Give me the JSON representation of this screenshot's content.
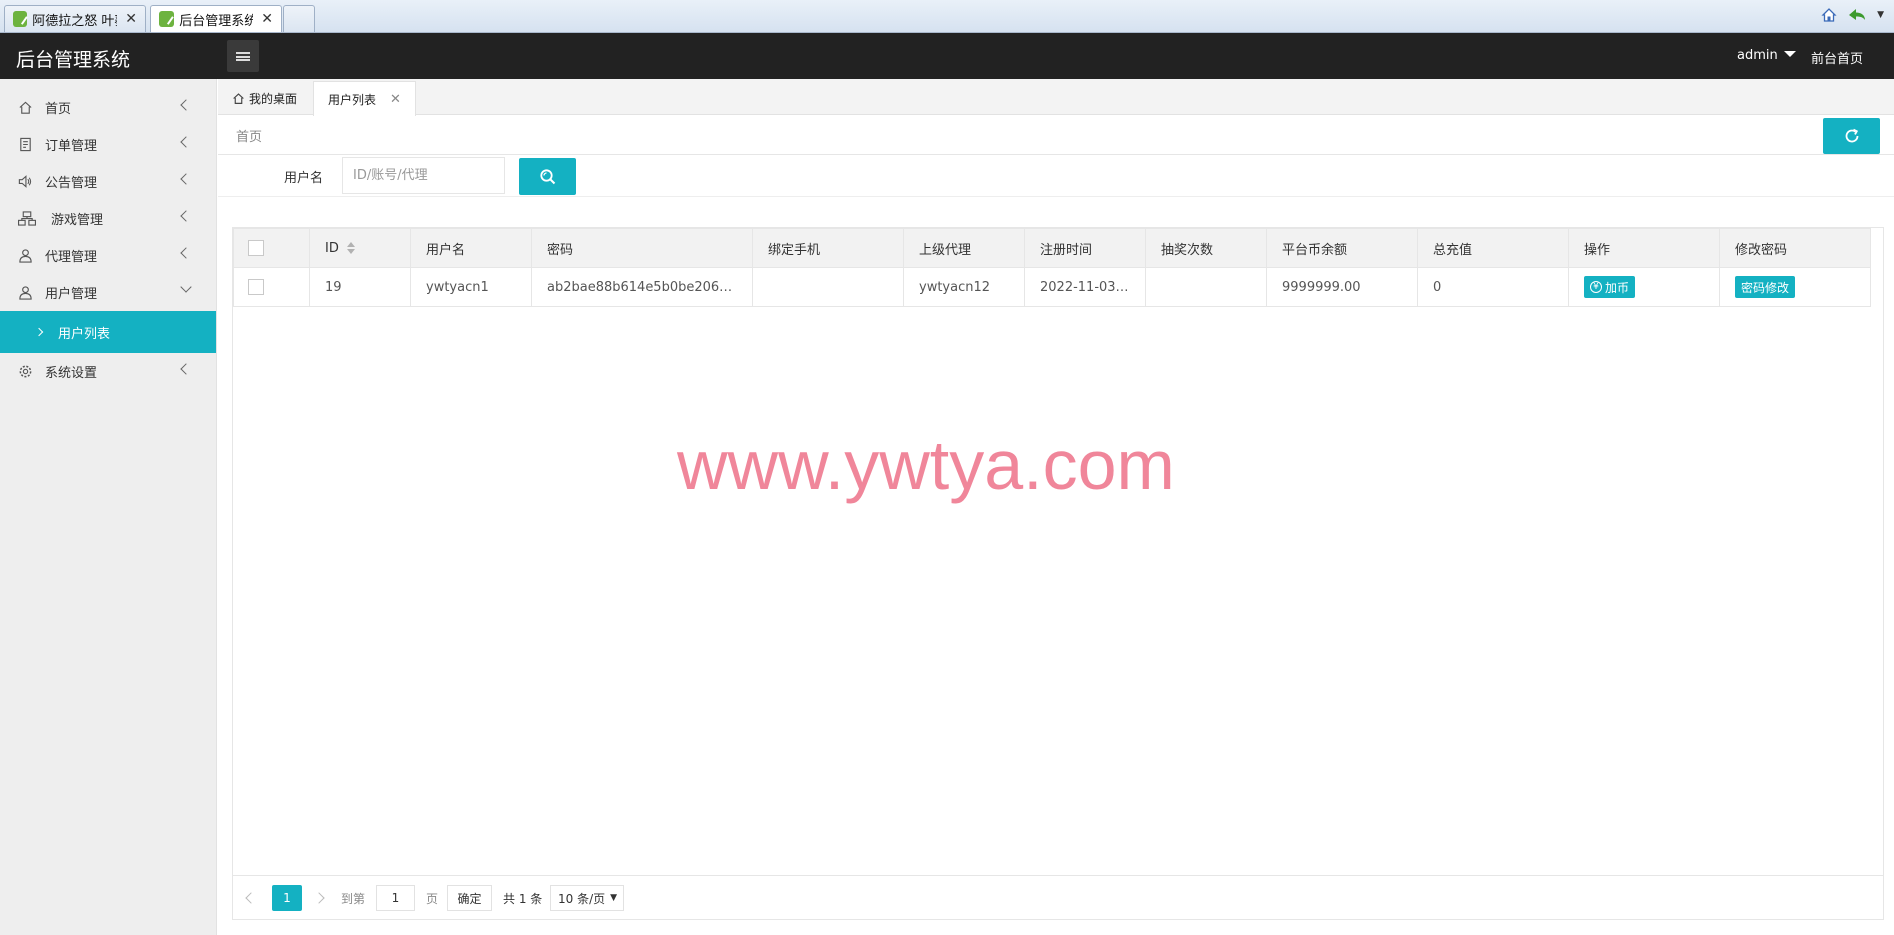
{
  "browser": {
    "tabs": [
      {
        "title": "阿德拉之怒 叶蓁"
      },
      {
        "title": "后台管理系统"
      }
    ]
  },
  "header": {
    "brand": "后台管理系统",
    "user": "admin",
    "front_link": "前台首页"
  },
  "sidebar": {
    "items": [
      {
        "label": "首页"
      },
      {
        "label": "订单管理"
      },
      {
        "label": "公告管理"
      },
      {
        "label": "游戏管理"
      },
      {
        "label": "代理管理"
      },
      {
        "label": "用户管理"
      },
      {
        "label": "系统设置"
      }
    ],
    "sub_item": "用户列表"
  },
  "content_tabs": {
    "desk": "我的桌面",
    "current": "用户列表"
  },
  "breadcrumb": "首页",
  "search": {
    "label": "用户名",
    "placeholder": "ID/账号/代理"
  },
  "table": {
    "headers": [
      "ID",
      "用户名",
      "密码",
      "绑定手机",
      "上级代理",
      "注册时间",
      "抽奖次数",
      "平台币余额",
      "总充值",
      "操作",
      "修改密码"
    ],
    "rows": [
      {
        "id": "19",
        "username": "ywtyacn1",
        "password": "ab2bae88b614e5b0be2061…",
        "phone": "",
        "agent": "ywtyacn12",
        "reg_time": "2022-11-03…",
        "draws": "",
        "balance": "9999999.00",
        "recharge": "0",
        "action": "加币",
        "change_pwd": "密码修改"
      }
    ]
  },
  "watermark": "www.ywtya.com",
  "pagination": {
    "current": "1",
    "goto_label": "到第",
    "goto_value": "1",
    "page_unit": "页",
    "confirm": "确定",
    "total": "共 1 条",
    "per_page": "10 条/页"
  }
}
